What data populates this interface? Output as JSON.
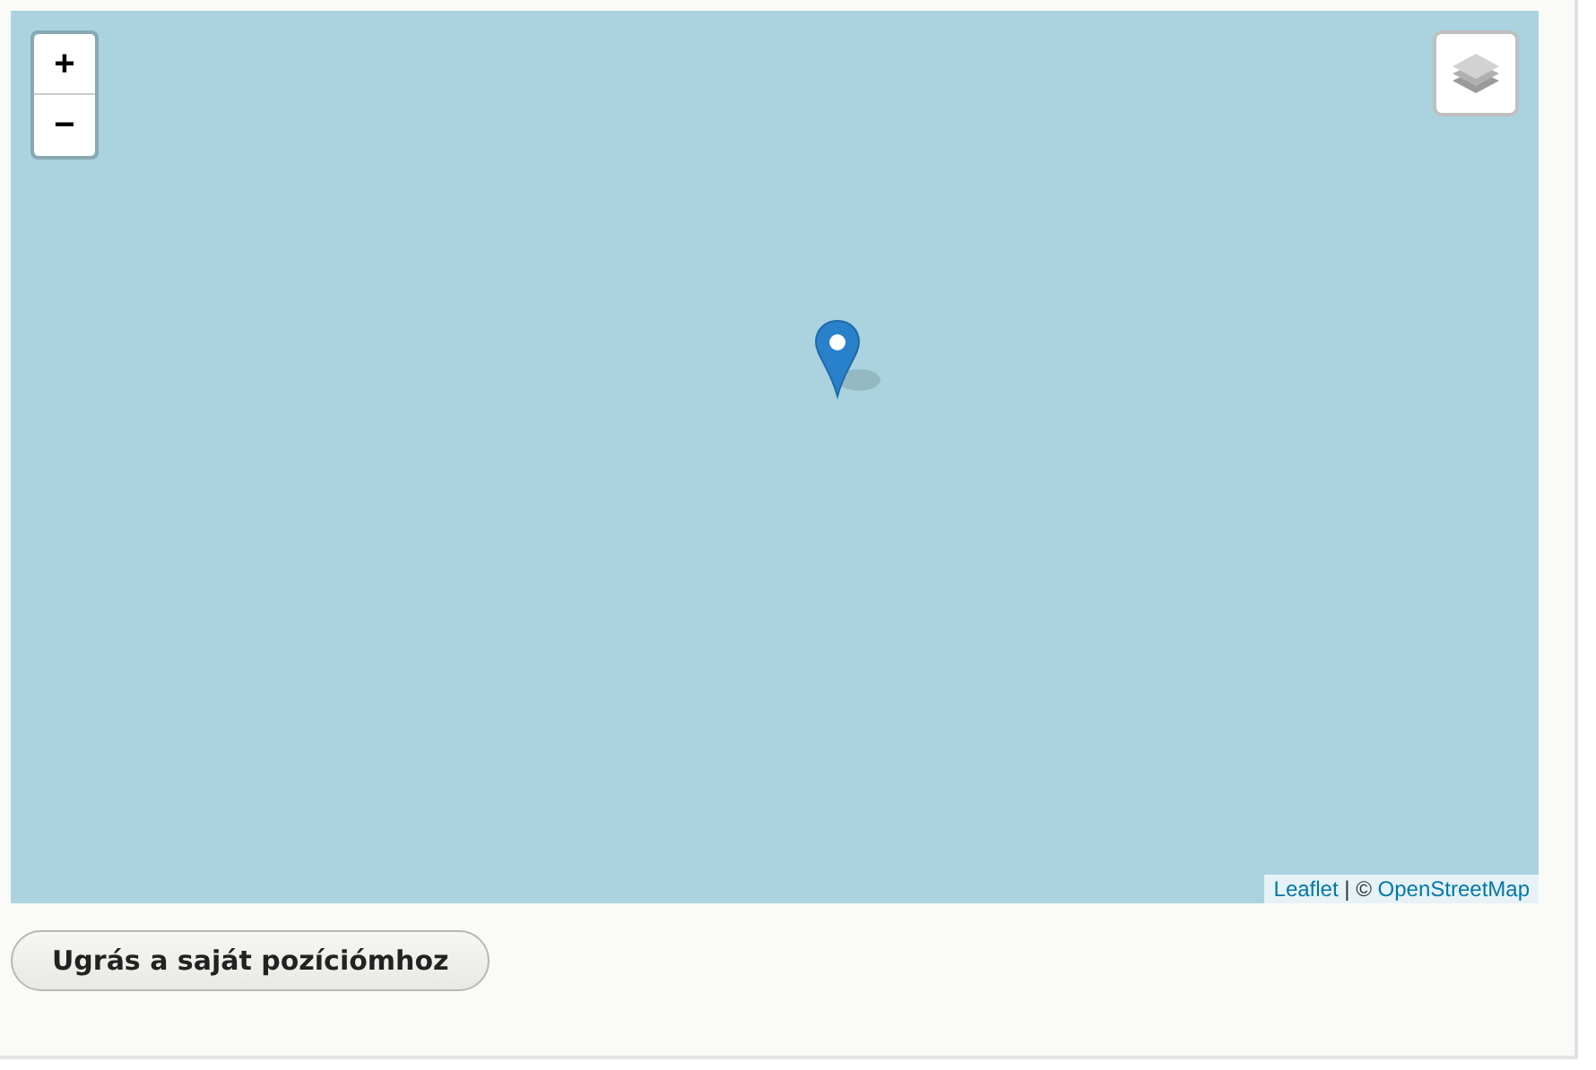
{
  "map": {
    "zoom_in": "+",
    "zoom_out": "−",
    "attribution": {
      "leaflet": "Leaflet",
      "separator": " | © ",
      "osm": "OpenStreetMap"
    }
  },
  "button": {
    "label": "Ugrás a saját pozíciómhoz"
  }
}
